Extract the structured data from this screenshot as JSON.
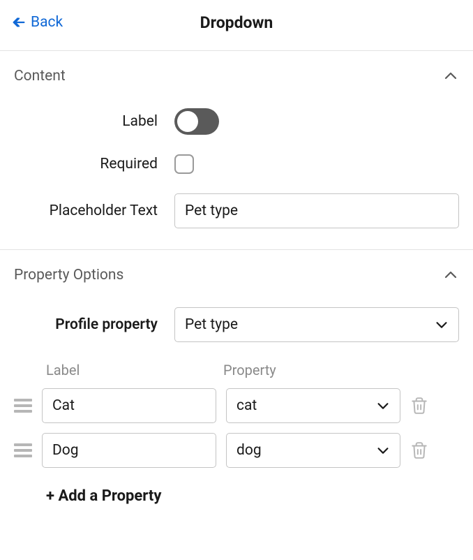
{
  "header": {
    "back_label": "Back",
    "title": "Dropdown"
  },
  "content_section": {
    "title": "Content",
    "rows": {
      "label_label": "Label",
      "required_label": "Required",
      "placeholder_label": "Placeholder Text",
      "placeholder_value": "Pet type"
    }
  },
  "property_options_section": {
    "title": "Property Options",
    "profile_property_label": "Profile property",
    "profile_property_value": "Pet type",
    "columns": {
      "label": "Label",
      "property": "Property"
    },
    "options": [
      {
        "label": "Cat",
        "property": "cat"
      },
      {
        "label": "Dog",
        "property": "dog"
      }
    ],
    "add_label": "+ Add a Property"
  }
}
